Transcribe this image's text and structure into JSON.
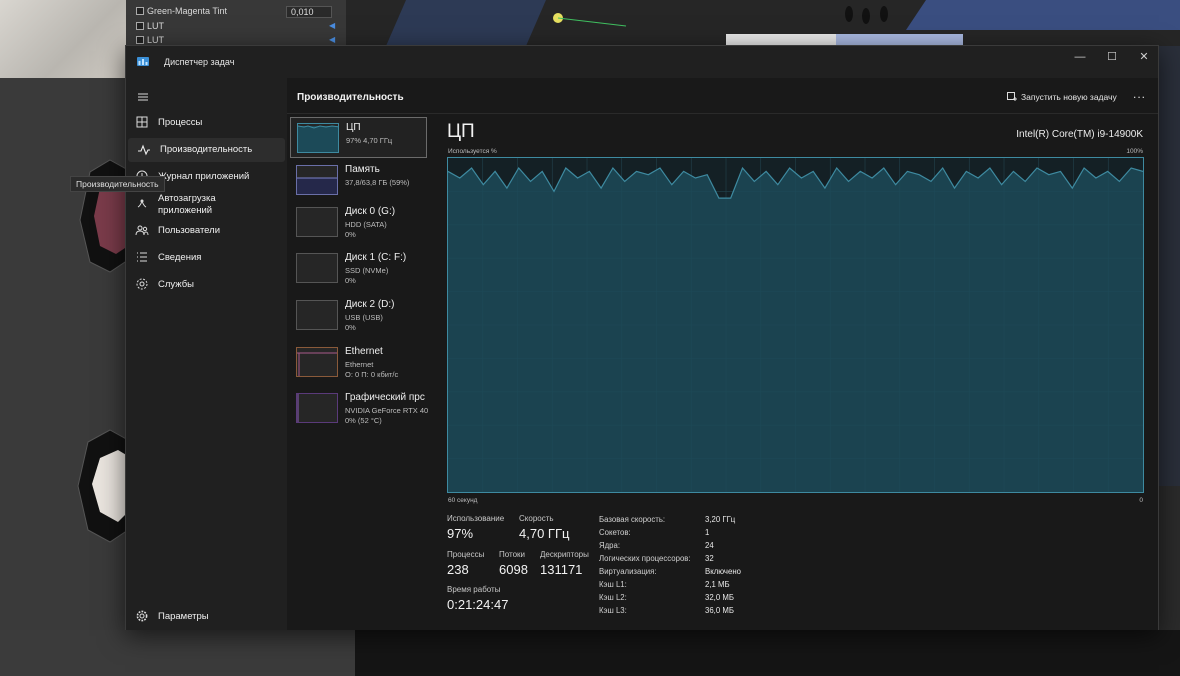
{
  "background": {
    "panel_rows": [
      {
        "label": "Green-Magenta Tint",
        "value": "0,010"
      },
      {
        "label": "LUT"
      },
      {
        "label": "LUT"
      }
    ]
  },
  "window": {
    "title": "Диспетчер задач",
    "controls": {
      "minimize": "—",
      "maximize": "☐",
      "close": "✕"
    }
  },
  "nav": {
    "tooltip": "Производительность",
    "items": [
      {
        "label": "Процессы",
        "icon": "processes-icon"
      },
      {
        "label": "Производительность",
        "icon": "performance-icon"
      },
      {
        "label": "Журнал приложений",
        "icon": "history-icon"
      },
      {
        "label": "Автозагрузка\nприложений",
        "icon": "startup-icon"
      },
      {
        "label": "Пользователи",
        "icon": "users-icon"
      },
      {
        "label": "Сведения",
        "icon": "details-icon"
      },
      {
        "label": "Службы",
        "icon": "services-icon"
      }
    ],
    "settings": "Параметры"
  },
  "header": {
    "title": "Производительность",
    "run_task": "Запустить новую задачу",
    "more": "..."
  },
  "resources": [
    {
      "name": "ЦП",
      "sub1": "97% 4,70 ГГц",
      "sub2": ""
    },
    {
      "name": "Память",
      "sub1": "37,8/63,8 ГБ (59%)",
      "sub2": ""
    },
    {
      "name": "Диск 0 (G:)",
      "sub1": "HDD (SATA)",
      "sub2": "0%"
    },
    {
      "name": "Диск 1 (C: F:)",
      "sub1": "SSD (NVMe)",
      "sub2": "0%"
    },
    {
      "name": "Диск 2 (D:)",
      "sub1": "USB (USB)",
      "sub2": "0%"
    },
    {
      "name": "Ethernet",
      "sub1": "Ethernet",
      "sub2": "О: 0 П: 0 кбит/с"
    },
    {
      "name": "Графический прс",
      "sub1": "NVIDIA GeForce RTX 40",
      "sub2": "0% (52 °C)"
    }
  ],
  "cpu": {
    "title": "ЦП",
    "model": "Intel(R) Core(TM) i9-14900K",
    "axis_top_left": "Используется %",
    "axis_top_right": "100%",
    "axis_bottom_left": "60 секунд",
    "axis_bottom_right": "0",
    "colors": {
      "line": "#3e8aa0",
      "fill": "#1c4a58",
      "grid": "#22434e"
    },
    "usage_history": [
      96,
      94,
      97,
      92,
      96,
      91,
      97,
      93,
      96,
      90,
      97,
      94,
      96,
      91,
      97,
      93,
      96,
      95,
      97,
      92,
      96,
      94,
      95,
      88,
      88,
      97,
      93,
      96,
      92,
      97,
      94,
      96,
      91,
      97,
      93,
      96,
      94,
      97,
      92,
      96,
      95,
      93,
      97,
      91,
      96,
      94,
      97,
      92,
      96,
      93,
      97,
      95,
      96,
      91,
      97,
      94,
      96,
      93,
      97,
      96
    ]
  },
  "stats": {
    "usage_label": "Использование",
    "usage": "97%",
    "speed_label": "Скорость",
    "speed": "4,70 ГГц",
    "processes_label": "Процессы",
    "processes": "238",
    "threads_label": "Потоки",
    "threads": "6098",
    "handles_label": "Дескрипторы",
    "handles": "131171",
    "uptime_label": "Время работы",
    "uptime": "0:21:24:47"
  },
  "specs": [
    {
      "k": "Базовая скорость:",
      "v": "3,20 ГГц"
    },
    {
      "k": "Сокетов:",
      "v": "1"
    },
    {
      "k": "Ядра:",
      "v": "24"
    },
    {
      "k": "Логических процессоров:",
      "v": "32"
    },
    {
      "k": "Виртуализация:",
      "v": "Включено"
    },
    {
      "k": "Кэш L1:",
      "v": "2,1 МБ"
    },
    {
      "k": "Кэш L2:",
      "v": "32,0 МБ"
    },
    {
      "k": "Кэш L3:",
      "v": "36,0 МБ"
    }
  ]
}
